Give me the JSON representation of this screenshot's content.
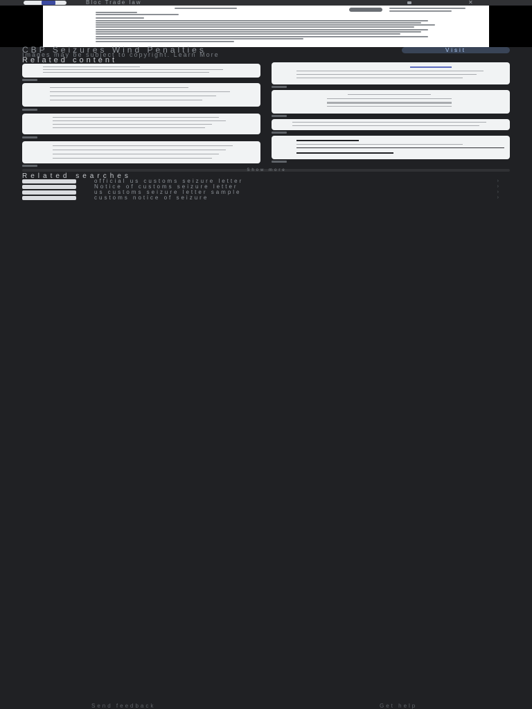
{
  "header": {
    "site_name": "Bloc Trade law",
    "close_label": "✕"
  },
  "result": {
    "title": "CBP Seizures Wind Penalties",
    "source_line": "Images may be subject to copyright. Learn More",
    "visit_label": "Visit"
  },
  "related_content": {
    "heading": "Related content"
  },
  "show_more": "Show more",
  "related_searches": {
    "heading": "Related searches",
    "items": [
      "official us customs seizure letter",
      "Notice of customs seizure letter",
      "us customs seizure letter sample",
      "customs notice of seizure"
    ]
  },
  "footer": {
    "feedback": "Send feedback",
    "help": "Get help"
  }
}
